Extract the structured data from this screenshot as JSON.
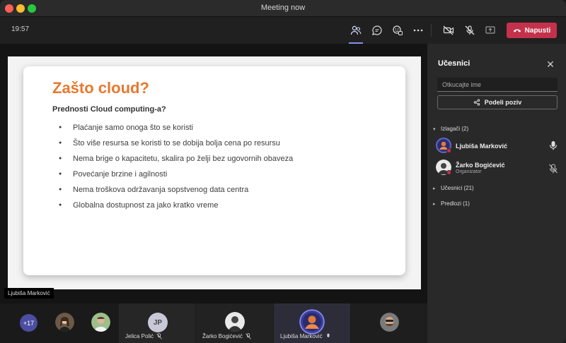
{
  "window": {
    "title": "Meeting now"
  },
  "toolbar": {
    "time": "19:57",
    "icons": [
      "people-icon",
      "chat-icon",
      "reactions-icon",
      "more-icon",
      "camera-off-icon",
      "mic-off-icon",
      "share-tray-icon"
    ],
    "leave_label": "Napusti",
    "leave_color": "#c4314b"
  },
  "slide": {
    "title": "Zašto cloud?",
    "subtitle": "Prednosti Cloud computing-a?",
    "bullets": [
      "Plaćanje samo onoga što se koristi",
      "Što više resursa se koristi to se dobija bolja cena po resursu",
      "Nema brige o kapacitetu, skalira po želji bez ugovornih obaveza",
      "Povećanje brzine i agilnosti",
      "Nema troškova održavanja sopstvenog data centra",
      "Globalna dostupnost za jako kratko vreme"
    ],
    "title_color": "#e8782e"
  },
  "stage": {
    "presenter_label": "Ljubiša Marković"
  },
  "panel": {
    "title": "Učesnici",
    "search_placeholder": "Otkucajte ime",
    "share_label": "Podeli poziv",
    "sections": {
      "speakers": "Izlagači (2)",
      "attendees": "Učesnici (21)",
      "lobby": "Predlozi (1)"
    },
    "members": [
      {
        "name": "Ljubiša Marković",
        "role": "",
        "mic": "mic-on"
      },
      {
        "name": "Žarko Bogićević",
        "role": "Organizator",
        "mic": "mic-off"
      }
    ]
  },
  "gallery": {
    "overflow_count": "+17",
    "tiles": [
      {
        "name": "Jelica Polić",
        "initials": "JP"
      },
      {
        "name": "Žarko Bogićević"
      },
      {
        "name": "Ljubiša Marković"
      }
    ]
  }
}
